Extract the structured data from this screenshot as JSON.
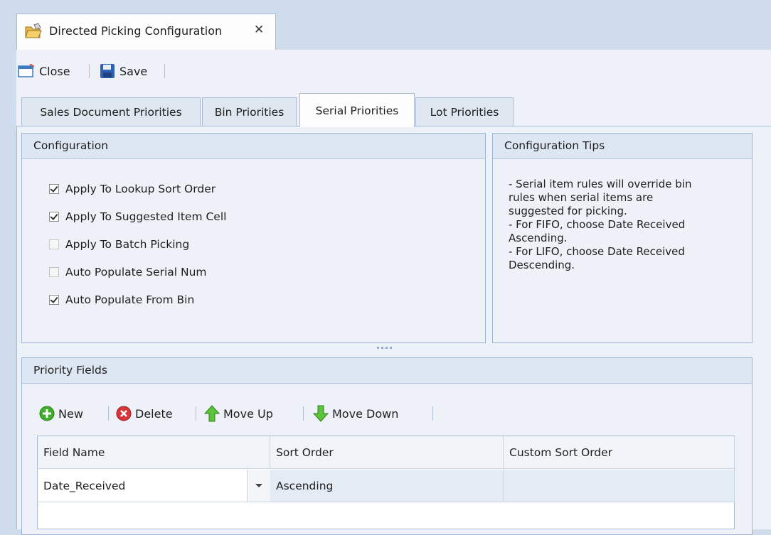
{
  "doc_tab": {
    "title": "Directed Picking Configuration",
    "close_symbol": "✕"
  },
  "toolbar": {
    "close_label": "Close",
    "save_label": "Save"
  },
  "tabs": [
    {
      "label": "Sales Document Priorities"
    },
    {
      "label": "Bin Priorities"
    },
    {
      "label": "Serial Priorities",
      "active": true
    },
    {
      "label": "Lot Priorities"
    }
  ],
  "configuration": {
    "title": "Configuration",
    "options": [
      {
        "label": "Apply To Lookup Sort Order",
        "checked": true
      },
      {
        "label": "Apply To Suggested Item Cell",
        "checked": true
      },
      {
        "label": "Apply To Batch Picking",
        "checked": false
      },
      {
        "label": "Auto Populate Serial Num",
        "checked": false
      },
      {
        "label": "Auto Populate From Bin",
        "checked": true
      }
    ]
  },
  "tips": {
    "title": "Configuration Tips",
    "lines": [
      "- Serial item rules will override bin",
      "rules when serial items are",
      "suggested for picking.",
      "- For FIFO, choose Date Received",
      "Ascending.",
      "- For LIFO, choose Date Received",
      "Descending."
    ]
  },
  "priority_fields": {
    "title": "Priority Fields",
    "buttons": {
      "new": "New",
      "delete": "Delete",
      "move_up": "Move Up",
      "move_down": "Move Down"
    },
    "columns": [
      "Field Name",
      "Sort Order",
      "Custom Sort Order"
    ],
    "rows": [
      {
        "field_name": "Date_Received",
        "sort_order": "Ascending",
        "custom_sort_order": ""
      }
    ]
  },
  "colors": {
    "accent": "#dde7f3",
    "frame": "#cfdceb",
    "green_icon": "#3fae2a",
    "red_icon": "#d9343a"
  }
}
